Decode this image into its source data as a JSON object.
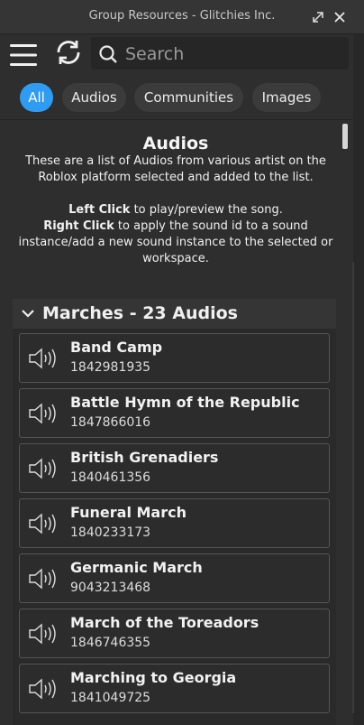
{
  "window": {
    "title": "Group Resources - Glitchies Inc."
  },
  "toolbar": {
    "search_placeholder": "Search"
  },
  "filters": [
    {
      "label": "All",
      "active": true
    },
    {
      "label": "Audios",
      "active": false
    },
    {
      "label": "Communities",
      "active": false
    },
    {
      "label": "Images",
      "active": false
    }
  ],
  "info": {
    "title": "Audios",
    "description": "These are a list of Audios from various artist on the Roblox platform selected and added to the list.",
    "left_click_label": "Left Click",
    "left_click_text": " to play/preview the song.",
    "right_click_label": "Right Click",
    "right_click_text": " to apply the sound id to a sound instance/add a new sound instance to the selected or workspace."
  },
  "section": {
    "title": "Marches - 23 Audios",
    "items": [
      {
        "name": "Band Camp",
        "id": "1842981935"
      },
      {
        "name": "Battle Hymn of the Republic",
        "id": "1847866016"
      },
      {
        "name": "British Grenadiers",
        "id": "1840461356"
      },
      {
        "name": "Funeral March",
        "id": "1840233173"
      },
      {
        "name": "Germanic March",
        "id": "9043213468"
      },
      {
        "name": "March of the Toreadors",
        "id": "1846746355"
      },
      {
        "name": "Marching to Georgia",
        "id": "1841049725"
      }
    ]
  },
  "colors": {
    "accent": "#2d9cf2",
    "background": "#2e2e2e"
  }
}
